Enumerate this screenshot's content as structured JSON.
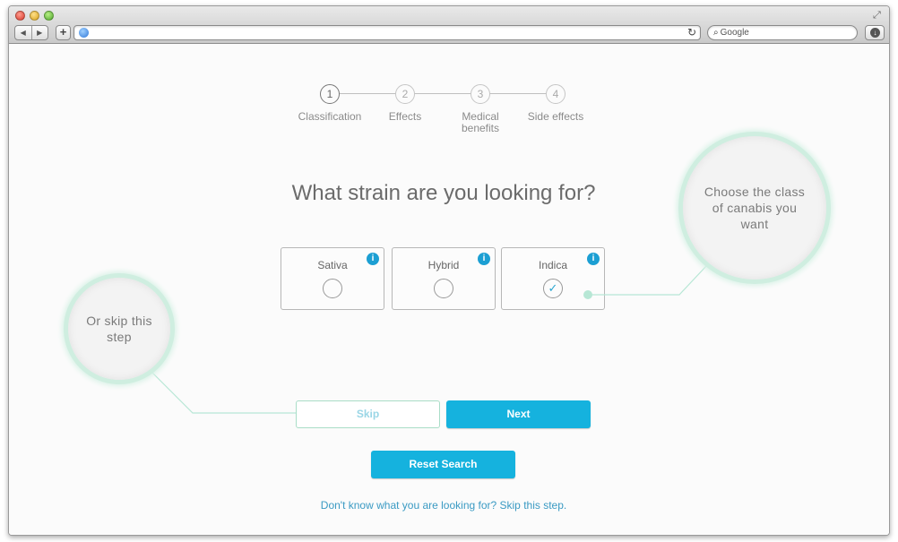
{
  "browser": {
    "search_placeholder": "Google",
    "back_glyph": "◀",
    "forward_glyph": "▶",
    "new_tab_glyph": "+",
    "reload_glyph": "↻",
    "search_glyph": "⌕",
    "download_glyph": "↓",
    "fullscreen_glyph": "⤢"
  },
  "steps": [
    {
      "number": "1",
      "label": "Classification",
      "active": true
    },
    {
      "number": "2",
      "label": "Effects",
      "active": false
    },
    {
      "number": "3",
      "label": "Medical benefits",
      "active": false
    },
    {
      "number": "4",
      "label": "Side effects",
      "active": false
    }
  ],
  "question": "What strain are you looking for?",
  "strains": [
    {
      "label": "Sativa",
      "selected": false,
      "mark": ""
    },
    {
      "label": "Hybrid",
      "selected": false,
      "mark": ""
    },
    {
      "label": "Indica",
      "selected": true,
      "mark": "✓"
    }
  ],
  "info_glyph": "i",
  "buttons": {
    "skip": "Skip",
    "next": "Next",
    "reset": "Reset Search"
  },
  "footer_link": "Don't know what you are looking for? Skip this step.",
  "callouts": {
    "class_hint": "Choose the class of canabis you want",
    "skip_hint": "Or skip this step"
  },
  "colors": {
    "accent": "#15b2de",
    "callout_ring": "#cfeee0",
    "connector": "#b7e7d5"
  }
}
